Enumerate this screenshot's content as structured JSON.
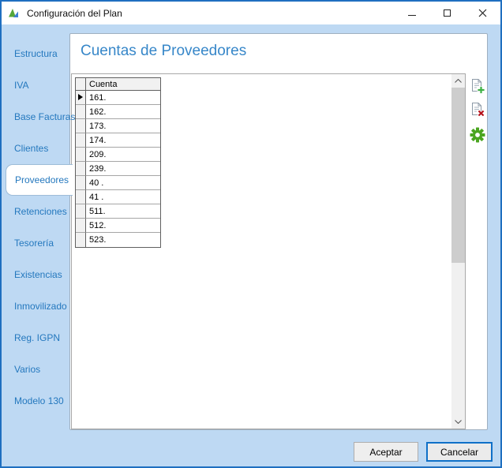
{
  "window": {
    "title": "Configuración del Plan",
    "controls": [
      {
        "name": "minimize"
      },
      {
        "name": "maximize"
      },
      {
        "name": "close"
      }
    ]
  },
  "sidebar": {
    "items": [
      {
        "label": "Estructura",
        "selected": false
      },
      {
        "label": "IVA",
        "selected": false
      },
      {
        "label": "Base Facturas",
        "selected": false
      },
      {
        "label": "Clientes",
        "selected": false
      },
      {
        "label": "Proveedores",
        "selected": true
      },
      {
        "label": "Retenciones",
        "selected": false
      },
      {
        "label": "Tesorería",
        "selected": false
      },
      {
        "label": "Existencias",
        "selected": false
      },
      {
        "label": "Inmovilizado",
        "selected": false
      },
      {
        "label": "Reg. IGPN",
        "selected": false
      },
      {
        "label": "Varios",
        "selected": false
      },
      {
        "label": "Modelo 130",
        "selected": false
      }
    ]
  },
  "main": {
    "title": "Cuentas de Proveedores",
    "table": {
      "columns": [
        "Cuenta"
      ],
      "rows": [
        "161.",
        "162.",
        "173.",
        "174.",
        "209.",
        "239.",
        "40 .",
        "41 .",
        "511.",
        "512.",
        "523."
      ],
      "current_row_index": 0
    },
    "toolbar": [
      {
        "name": "add-account-icon"
      },
      {
        "name": "delete-account-icon"
      },
      {
        "name": "settings-gear-icon"
      }
    ]
  },
  "footer": {
    "buttons": [
      {
        "label": "Aceptar",
        "default": false
      },
      {
        "label": "Cancelar",
        "default": true
      }
    ]
  },
  "colors": {
    "window_border": "#1f6fc0",
    "content_background": "#bed9f3",
    "sidebar_text": "#2478be",
    "panel_title": "#3787c9",
    "gear_green": "#4aa520",
    "plus_green": "#3db044",
    "delete_red": "#b5121b",
    "scroll_thumb": "#cdcdcd"
  }
}
